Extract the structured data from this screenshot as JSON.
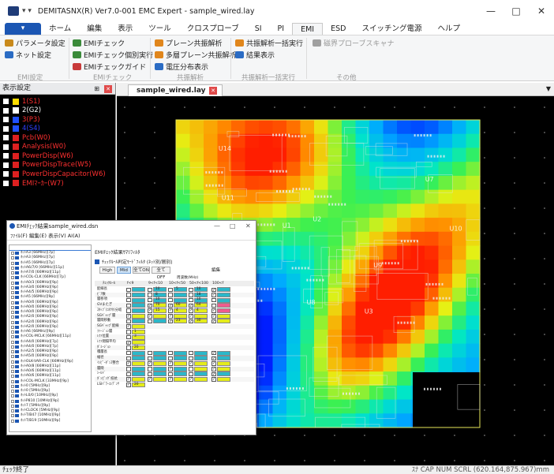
{
  "window": {
    "title": "DEMITASNX(R) Ver7.0-001 EMC Expert - sample_wired.lay",
    "qa": "▾ ▾"
  },
  "menu": {
    "file": "▾",
    "tabs": [
      "ホーム",
      "編集",
      "表示",
      "ツール",
      "クロスプローブ",
      "SI",
      "PI",
      "EMI",
      "ESD",
      "スイッチング電源",
      "ヘルプ"
    ],
    "active": "EMI"
  },
  "ribbon": {
    "groups": [
      "EMI設定",
      "EMIチェック",
      "共振解析",
      "共振解析一括実行",
      "その他"
    ],
    "items": [
      {
        "label": "パラメータ設定",
        "color": "#c98a1c"
      },
      {
        "label": "ネット設定",
        "color": "#2b6cc4"
      },
      {
        "label": "EMIチェック",
        "color": "#3a8a3a"
      },
      {
        "label": "EMIチェック個別実行 -",
        "color": "#3a8a3a"
      },
      {
        "label": "EMIチェックガイド",
        "color": "#c83a3a"
      },
      {
        "label": "プレーン共振解析",
        "color": "#e0861c"
      },
      {
        "label": "多層プレーン共振解析",
        "color": "#e0861c"
      },
      {
        "label": "電圧分布表示",
        "color": "#2b6cc4"
      },
      {
        "label": "共振解析一括実行",
        "color": "#e0861c"
      },
      {
        "label": "結果表示",
        "color": "#2b6cc4"
      },
      {
        "label": "磁界プローブスキャナ",
        "color": "#a0a0a0"
      }
    ]
  },
  "left_panel": {
    "title": "表示設定",
    "layers": [
      {
        "label": "1(S1)",
        "color": "#ffdd00",
        "text": "#ff3030"
      },
      {
        "label": "2(G2)",
        "color": "#ffffff",
        "text": "#ffffff"
      },
      {
        "label": "3(P3)",
        "color": "#2050ff",
        "text": "#ff3030"
      },
      {
        "label": "4(S4)",
        "color": "#2050ff",
        "text": "#3040ff"
      },
      {
        "label": "Pcb(W0)",
        "color": "#dd2020",
        "text": "#ff3030"
      },
      {
        "label": "Analysis(W0)",
        "color": "#dd2020",
        "text": "#ff3030"
      },
      {
        "label": "PowerDisp(W6)",
        "color": "#dd2020",
        "text": "#ff3030"
      },
      {
        "label": "PowerDispTrace(W5)",
        "color": "#dd2020",
        "text": "#ff3030"
      },
      {
        "label": "PowerDispCapacitor(W6)",
        "color": "#dd2020",
        "text": "#ff3030"
      },
      {
        "label": "EMIﾏｰｶｰ(W7)",
        "color": "#dd2020",
        "text": "#ff3030"
      }
    ]
  },
  "document": {
    "tab": "sample_wired.lay"
  },
  "board": {
    "labels": [
      "U14",
      "U11",
      "U1",
      "U2",
      "U3",
      "U8",
      "U9",
      "U10",
      "U7"
    ]
  },
  "status": {
    "left": "ﾁｪｯｸ終了",
    "right": "ｽﾅ CAP NUM SCRL (620.164,875.967)mm"
  },
  "emi_window": {
    "title": "EMIﾁｪｯｸ結果sample_wired.dsn",
    "controls": [
      "—",
      "□",
      "✕"
    ],
    "menu": "ﾌｧｲﾙ(F)   編集(E)   表示(V)   AI(A)",
    "tree_items": [
      "ﾈｯﾄA3 [66MHz][7p]",
      "ﾈｯﾄA3 [66MHz][7p]",
      "ﾈｯﾄA5 [66MHz][7p]",
      "ﾈｯﾄA6/7/0 [66MHz][11p]",
      "ﾈｯﾄA7/0 [66MHz][11p]",
      "ﾈｯﾄCOL-CLK [66MHz][7p]",
      "ﾈｯﾄA0/3 [66MHz][9p]",
      "ﾈｯﾄA3/0 [66MHz][9p]",
      "ﾈｯﾄA4/5 [66MHz][9p]",
      "ﾈｯﾄA5 [66MHz][9p]",
      "ﾈｯﾄA0/0 [66MHz][9p]",
      "ﾈｯﾄA0/0 [66MHz][9p]",
      "ﾈｯﾄA0/0 [66MHz][9p]",
      "ﾈｯﾄA2/0 [66MHz][9p]",
      "ﾈｯﾄA2/0 [66MHz][9p]",
      "ﾈｯﾄA2/0 [66MHz][9p]",
      "ﾈｯﾄA6 [66MHz][9p]",
      "ﾈｯﾄCOL-MCLK [66MHz][11p]",
      "ﾈｯﾄA4/0 [66MHz][7p]",
      "ﾈｯﾄA4/0 [66MHz][7p]",
      "ﾈｯﾄA2/5 [66MHz][9p]",
      "ﾈｯﾄA5/0 [66MHz][9p]",
      "ﾈｯﾄOLK-VAR-CLK [66MHz][9p]",
      "ﾈｯﾄA0/8 [66MHz][11p]",
      "ﾈｯﾄA0/6 [66MHz][11p]",
      "ﾈｯﾄA0/6 [66MHz][11p]",
      "ﾈｯﾄCOL-MCLK [33MHz][9p]",
      "ﾈｯﾄ0 [5MHz][9p]",
      "ﾈｯﾄ0 [5MHz][9p]",
      "ﾈｯﾄL0/0 [10MHz][9p]",
      "ﾈｯﾄP810 [10MHz][9p]",
      "ﾈｯﾄ7 [5MHz][9p]",
      "ﾈｯﾄCLOCK [5MHz][9p]",
      "ﾈｯﾄT/B47 [10MHz][9p]",
      "ﾈｯﾄT/B19 [10MHz][9p]"
    ],
    "summary_title": "EMIﾁｪｯｸ結果ｻﾏﾘﾌｨﾙﾀ",
    "filter_label": "ﾁｪｯｸﾙｰﾙ判定ﾓｰﾄﾞﾌｨﾙﾀ  (ﾈｯﾄ別/層別)",
    "buttons": [
      "High",
      "Mid",
      "全てON",
      "全てOFF"
    ],
    "edit": "編集",
    "grid_header": {
      "freq": "周波数(MHz)",
      "rule": "ﾁｪｯｸﾙｰﾙ",
      "cols": [
        "f<9",
        "9<f<10",
        "10<f<50",
        "50<f<100",
        "100<f"
      ]
    },
    "rows": [
      {
        "name": "配線長",
        "cells": [
          "c",
          "c",
          "c",
          "c",
          "c"
        ],
        "nums": [
          "",
          "10",
          "5",
          "10",
          ""
        ],
        "chk": [
          0,
          0,
          0,
          0,
          1
        ]
      },
      {
        "name": "ﾋﾞｱ数",
        "cells": [
          "c",
          "c",
          "c",
          "c",
          "c"
        ],
        "nums": [
          "",
          "8",
          "",
          "18",
          ""
        ],
        "chk": [
          0,
          0,
          0,
          0,
          1
        ]
      },
      {
        "name": "層移項",
        "cells": [
          "c",
          "c",
          "c",
          "c",
          "c"
        ],
        "nums": [
          "",
          "10",
          "",
          "10",
          ""
        ],
        "chk": [
          0,
          0,
          0,
          0,
          0
        ]
      },
      {
        "name": "GVまたぎ",
        "cells": [
          "c",
          "y",
          "y",
          "y",
          "p"
        ],
        "nums": [
          "",
          "70",
          "60",
          "64",
          ""
        ],
        "chk": [
          0,
          1,
          1,
          1,
          0
        ]
      },
      {
        "name": "ｽﾀｯﾌﾞ(ｺﾈｸﾀ)分岐",
        "cells": [
          "c",
          "y",
          "y",
          "y",
          "p"
        ],
        "nums": [
          "",
          "15",
          "4",
          "4",
          ""
        ],
        "chk": [
          0,
          1,
          1,
          1,
          1
        ]
      },
      {
        "name": "SGｷﾞｬｯﾌﾟ層",
        "cells": [
          "y",
          "y",
          "y",
          "y",
          "y"
        ],
        "nums": [
          "",
          "",
          "",
          "",
          ""
        ],
        "chk": [
          1,
          1,
          1,
          1,
          1
        ]
      },
      {
        "name": "層間移動",
        "cells": [
          "c",
          "c",
          "y",
          "y",
          "y"
        ],
        "nums": [
          "",
          "",
          "23",
          "30",
          ""
        ],
        "chk": [
          0,
          0,
          1,
          1,
          1
        ]
      },
      {
        "name": "SGｷﾞｬｯﾌﾟ配線",
        "cells": [
          "y",
          "",
          "",
          "",
          ""
        ],
        "nums": [
          "",
          "",
          "",
          "",
          ""
        ],
        "chk": [
          1,
          0,
          0,
          0,
          0
        ]
      },
      {
        "name": "ﾌｧｰｼﾞｮﾝ層",
        "cells": [
          "y",
          "",
          "",
          "",
          ""
        ],
        "nums": [
          "1",
          "",
          "",
          "",
          ""
        ],
        "chk": [
          0,
          0,
          0,
          0,
          0
        ]
      },
      {
        "name": "ﾚﾌｧ位置",
        "cells": [
          "y",
          "",
          "",
          "",
          ""
        ],
        "nums": [
          "3",
          "",
          "",
          "",
          ""
        ],
        "chk": [
          0,
          0,
          0,
          0,
          0
        ]
      },
      {
        "name": "ﾚﾌｧ間隔平均",
        "cells": [
          "y",
          "",
          "",
          "",
          ""
        ],
        "nums": [
          "",
          "",
          "",
          "",
          ""
        ],
        "chk": [
          1,
          0,
          0,
          0,
          0
        ]
      },
      {
        "name": "ﾀﾞﾐｰｼﾞｮﾝ",
        "cells": [
          "y",
          "",
          "",
          "",
          ""
        ],
        "nums": [
          "20",
          "",
          "",
          "",
          ""
        ],
        "chk": [
          0,
          0,
          0,
          0,
          0
        ]
      },
      {
        "name": "積層長",
        "cells": [
          "c",
          "c",
          "c",
          "c",
          "c"
        ],
        "nums": [
          "",
          "",
          "",
          "",
          ""
        ],
        "chk": [
          0,
          0,
          0,
          0,
          1
        ]
      },
      {
        "name": "幅径",
        "cells": [
          "c",
          "c",
          "c",
          "c",
          "c"
        ],
        "nums": [
          "",
          "",
          "",
          "",
          ""
        ],
        "chk": [
          0,
          0,
          0,
          0,
          1
        ]
      },
      {
        "name": "ｲﾝﾋﾟｰﾀﾞﾝｽ整合",
        "cells": [
          "y",
          "y",
          "y",
          "y",
          "y"
        ],
        "nums": [
          "",
          "",
          "",
          "",
          ""
        ],
        "chk": [
          1,
          1,
          1,
          1,
          1
        ]
      },
      {
        "name": "層間",
        "cells": [
          "c",
          "c",
          "c",
          "y",
          "y"
        ],
        "nums": [
          "",
          "",
          "",
          "",
          ""
        ],
        "chk": [
          0,
          0,
          1,
          0,
          1
        ]
      },
      {
        "name": "ｼｰﾙﾄﾞ",
        "cells": [
          "c",
          "c",
          "c",
          "c",
          "c"
        ],
        "nums": [
          "",
          "",
          "",
          "",
          ""
        ],
        "chk": [
          0,
          0,
          0,
          0,
          1
        ]
      },
      {
        "name": "ﾀﾞﾝﾋﾟﾝｸﾞ抵抗",
        "cells": [
          "y",
          "y",
          "y",
          "y",
          "y"
        ],
        "nums": [
          "",
          "",
          "",
          "",
          ""
        ],
        "chk": [
          1,
          1,
          1,
          1,
          1
        ]
      },
      {
        "name": "LSIﾊﾟﾜｰｺﾝﾃﾞﾝｻ",
        "cells": [
          "y",
          "",
          "",
          "",
          ""
        ],
        "nums": [
          "20",
          "",
          "",
          "",
          ""
        ],
        "chk": [
          1,
          0,
          0,
          0,
          0
        ]
      }
    ]
  },
  "colors": {
    "accent": "#1b56b3",
    "ribbon_bg": "#f5f6f7",
    "cyan": "#2bb7c9",
    "yellow": "#e4ec1a",
    "pink": "#ef5c8e"
  }
}
